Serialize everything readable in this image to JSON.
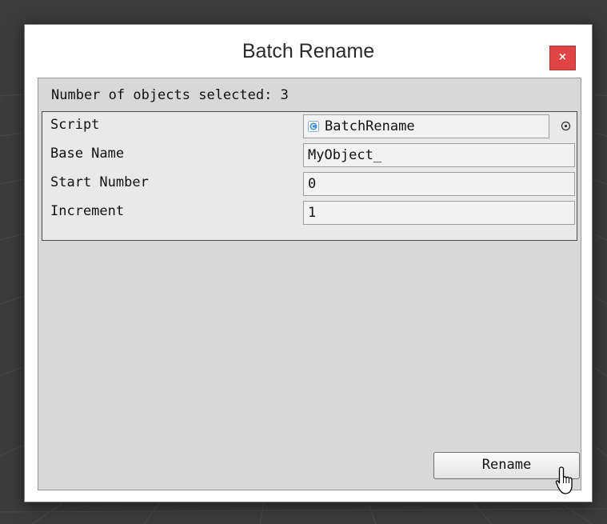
{
  "window": {
    "title": "Batch Rename",
    "close_label": "×"
  },
  "panel": {
    "selected_count_text": "Number of objects selected: 3"
  },
  "inspector": {
    "script": {
      "label": "Script",
      "value": "BatchRename",
      "icon": "csharp-script-icon",
      "picker_icon": "object-picker-icon"
    },
    "base_name": {
      "label": "Base Name",
      "value": "MyObject_"
    },
    "start_number": {
      "label": "Start Number",
      "value": "0"
    },
    "increment": {
      "label": "Increment",
      "value": "1"
    }
  },
  "actions": {
    "rename_label": "Rename"
  },
  "colors": {
    "close_button": "#e04343",
    "panel_background": "#d8d8d8",
    "backdrop": "#3c3c3c",
    "script_icon_blue": "#3a8fd6"
  }
}
